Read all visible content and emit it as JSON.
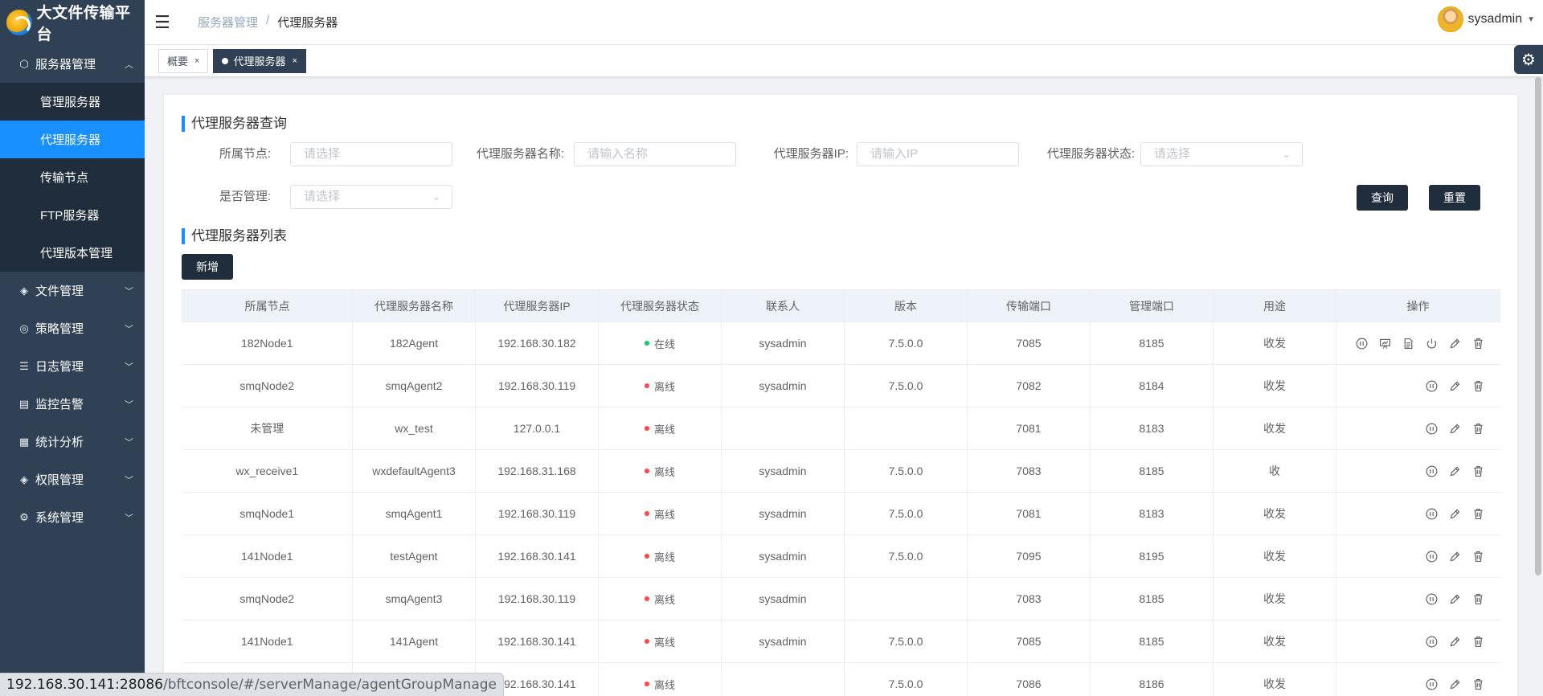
{
  "app": {
    "title": "大文件传输平台"
  },
  "header": {
    "breadcrumb": [
      "服务器管理",
      "代理服务器"
    ],
    "user": "sysadmin"
  },
  "sidebar": {
    "items": [
      {
        "label": "服务器管理",
        "icon": "cube-icon",
        "expanded": true,
        "children": [
          "管理服务器",
          "代理服务器",
          "传输节点",
          "FTP服务器",
          "代理版本管理"
        ],
        "active_child": 1
      },
      {
        "label": "文件管理",
        "icon": "layers-icon"
      },
      {
        "label": "策略管理",
        "icon": "target-icon"
      },
      {
        "label": "日志管理",
        "icon": "list-icon"
      },
      {
        "label": "监控告警",
        "icon": "monitor-icon"
      },
      {
        "label": "统计分析",
        "icon": "grid-icon"
      },
      {
        "label": "权限管理",
        "icon": "layers-icon"
      },
      {
        "label": "系统管理",
        "icon": "gear-icon"
      }
    ]
  },
  "tabs": [
    {
      "label": "概要",
      "active": false
    },
    {
      "label": "代理服务器",
      "active": true
    }
  ],
  "query": {
    "title": "代理服务器查询",
    "fields": {
      "node": {
        "label": "所属节点:",
        "placeholder": "请选择"
      },
      "name": {
        "label": "代理服务器名称:",
        "placeholder": "请输入名称"
      },
      "ip": {
        "label": "代理服务器IP:",
        "placeholder": "请输入IP"
      },
      "status": {
        "label": "代理服务器状态:",
        "placeholder": "请选择"
      },
      "managed": {
        "label": "是否管理:",
        "placeholder": "请选择"
      }
    },
    "search_label": "查询",
    "reset_label": "重置"
  },
  "list": {
    "title": "代理服务器列表",
    "add_label": "新增",
    "columns": [
      "所属节点",
      "代理服务器名称",
      "代理服务器IP",
      "代理服务器状态",
      "联系人",
      "版本",
      "传输端口",
      "管理端口",
      "用途",
      "操作"
    ],
    "rows": [
      {
        "node": "182Node1",
        "name": "182Agent",
        "ip": "192.168.30.182",
        "status": "在线",
        "online": true,
        "contact": "sysadmin",
        "version": "7.5.0.0",
        "tport": "7085",
        "mport": "8185",
        "usage": "收发"
      },
      {
        "node": "smqNode2",
        "name": "smqAgent2",
        "ip": "192.168.30.119",
        "status": "离线",
        "online": false,
        "contact": "sysadmin",
        "version": "7.5.0.0",
        "tport": "7082",
        "mport": "8184",
        "usage": "收发"
      },
      {
        "node": "未管理",
        "name": "wx_test",
        "ip": "127.0.0.1",
        "status": "离线",
        "online": false,
        "contact": "",
        "version": "",
        "tport": "7081",
        "mport": "8183",
        "usage": "收发"
      },
      {
        "node": "wx_receive1",
        "name": "wxdefaultAgent3",
        "ip": "192.168.31.168",
        "status": "离线",
        "online": false,
        "contact": "sysadmin",
        "version": "7.5.0.0",
        "tport": "7083",
        "mport": "8185",
        "usage": "收"
      },
      {
        "node": "smqNode1",
        "name": "smqAgent1",
        "ip": "192.168.30.119",
        "status": "离线",
        "online": false,
        "contact": "sysadmin",
        "version": "7.5.0.0",
        "tport": "7081",
        "mport": "8183",
        "usage": "收发"
      },
      {
        "node": "141Node1",
        "name": "testAgent",
        "ip": "192.168.30.141",
        "status": "离线",
        "online": false,
        "contact": "sysadmin",
        "version": "7.5.0.0",
        "tport": "7095",
        "mport": "8195",
        "usage": "收发"
      },
      {
        "node": "smqNode2",
        "name": "smqAgent3",
        "ip": "192.168.30.119",
        "status": "离线",
        "online": false,
        "contact": "sysadmin",
        "version": "",
        "tport": "7083",
        "mport": "8185",
        "usage": "收发"
      },
      {
        "node": "141Node1",
        "name": "141Agent",
        "ip": "192.168.30.141",
        "status": "离线",
        "online": false,
        "contact": "sysadmin",
        "version": "7.5.0.0",
        "tport": "7085",
        "mport": "8185",
        "usage": "收发"
      },
      {
        "node": "",
        "name": "",
        "ip": "192.168.30.141",
        "status": "离线",
        "online": false,
        "contact": "",
        "version": "7.5.0.0",
        "tport": "7086",
        "mport": "8186",
        "usage": "收发"
      }
    ]
  },
  "colors": {
    "online": "#13ce66",
    "offline": "#ff4949",
    "accent": "#1890ff",
    "sidebar": "#304156"
  },
  "status_bar": {
    "host": "192.168.30.141:28086",
    "path": "/bftconsole/#/serverManage/agentGroupManage"
  }
}
